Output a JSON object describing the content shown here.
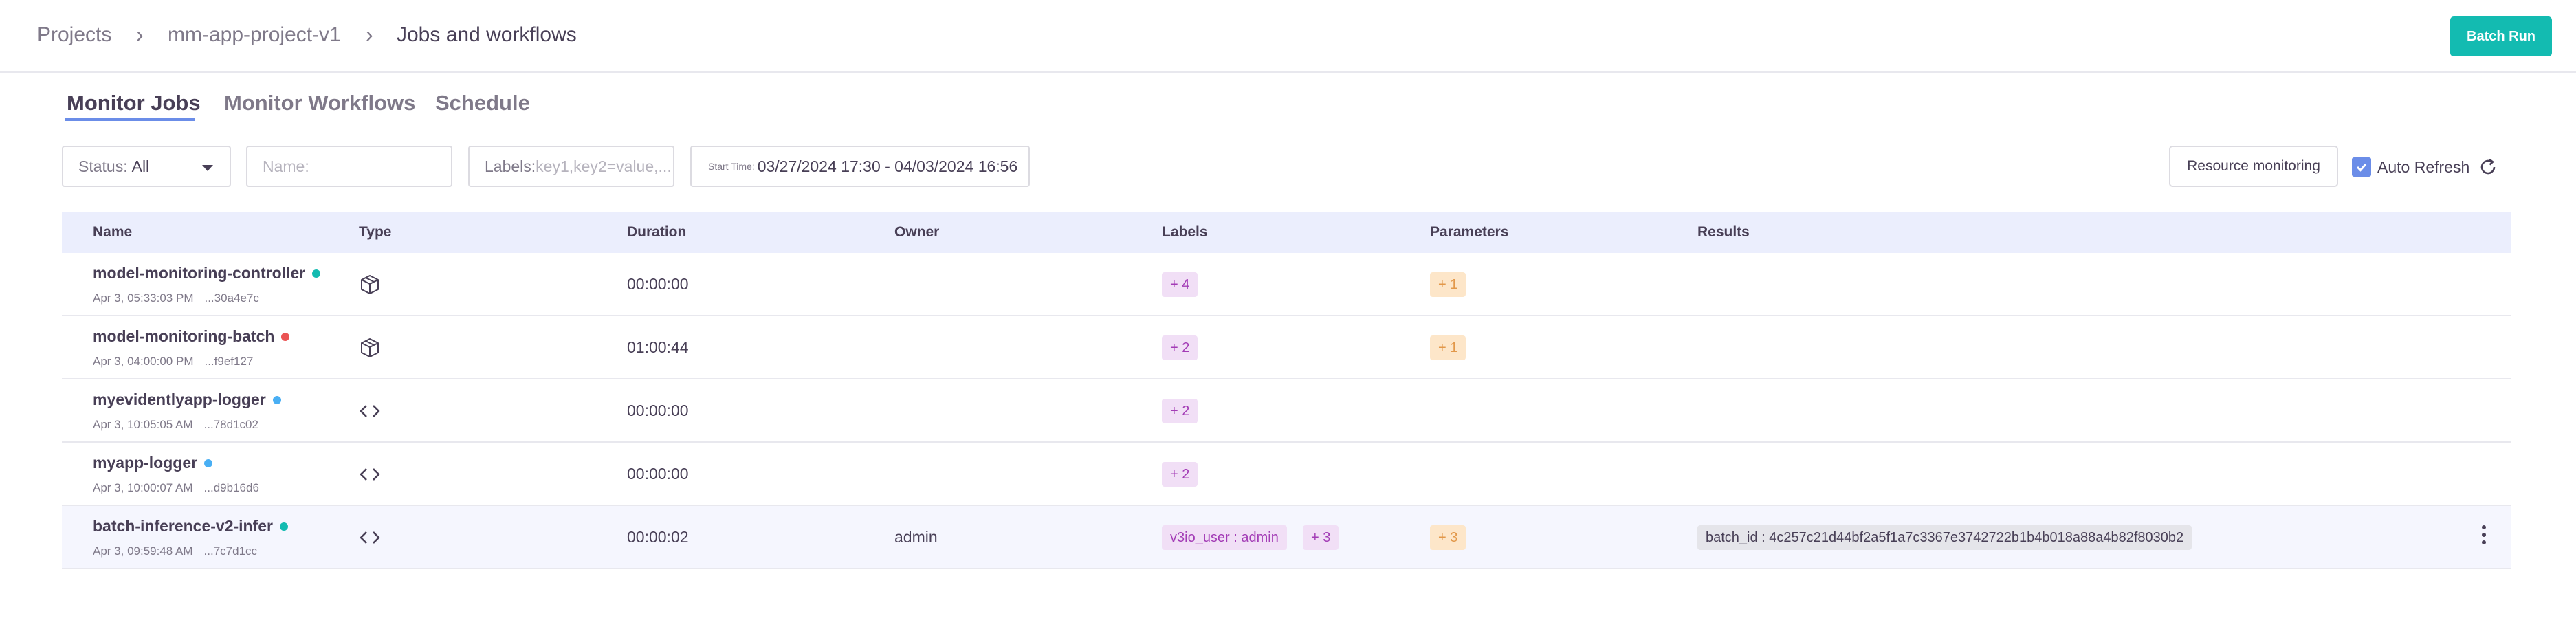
{
  "breadcrumb": {
    "items": [
      "Projects",
      "mm-app-project-v1",
      "Jobs and workflows"
    ]
  },
  "header": {
    "batch_run_label": "Batch Run"
  },
  "tabs": [
    {
      "label": "Monitor Jobs",
      "active": true
    },
    {
      "label": "Monitor Workflows",
      "active": false
    },
    {
      "label": "Schedule",
      "active": false
    }
  ],
  "filters": {
    "status_label": "Status:",
    "status_value": "All",
    "name_placeholder": "Name:",
    "labels_prefix": "Labels:",
    "labels_placeholder": "key1,key2=value,...",
    "start_time_label": "Start Time:",
    "start_time_value": "03/27/2024 17:30 - 04/03/2024 16:56",
    "resource_monitoring_label": "Resource monitoring",
    "auto_refresh_label": "Auto Refresh",
    "auto_refresh_checked": true
  },
  "table": {
    "columns": [
      "Name",
      "Type",
      "Duration",
      "Owner",
      "Labels",
      "Parameters",
      "Results"
    ],
    "rows": [
      {
        "name": "model-monitoring-controller",
        "status_color": "#13bbb1",
        "date": "Apr 3, 05:33:03 PM",
        "uid": "...30a4e7c",
        "type_icon": "package-icon",
        "duration": "00:00:00",
        "owner": "",
        "labels": [
          "+ 4"
        ],
        "parameters": [
          "+ 1"
        ],
        "results": []
      },
      {
        "name": "model-monitoring-batch",
        "status_color": "#eb5454",
        "date": "Apr 3, 04:00:00 PM",
        "uid": "...f9ef127",
        "type_icon": "package-icon",
        "duration": "01:00:44",
        "owner": "",
        "labels": [
          "+ 2"
        ],
        "parameters": [
          "+ 1"
        ],
        "results": []
      },
      {
        "name": "myevidentlyapp-logger",
        "status_color": "#49aff4",
        "date": "Apr 3, 10:05:05 AM",
        "uid": "...78d1c02",
        "type_icon": "code-icon",
        "duration": "00:00:00",
        "owner": "",
        "labels": [
          "+ 2"
        ],
        "parameters": [],
        "results": []
      },
      {
        "name": "myapp-logger",
        "status_color": "#49aff4",
        "date": "Apr 3, 10:00:07 AM",
        "uid": "...d9b16d6",
        "type_icon": "code-icon",
        "duration": "00:00:00",
        "owner": "",
        "labels": [
          "+ 2"
        ],
        "parameters": [],
        "results": []
      },
      {
        "name": "batch-inference-v2-infer",
        "status_color": "#13bbb1",
        "date": "Apr 3, 09:59:48 AM",
        "uid": "...7c7d1cc",
        "type_icon": "code-icon",
        "duration": "00:00:02",
        "owner": "admin",
        "labels": [
          "v3io_user : admin",
          "+ 3"
        ],
        "parameters": [
          "+ 3"
        ],
        "results": [
          "batch_id : 4c257c21d44bf2a5f1a7c3367e3742722b1b4b018a88a4b82f8030b2"
        ]
      }
    ]
  }
}
